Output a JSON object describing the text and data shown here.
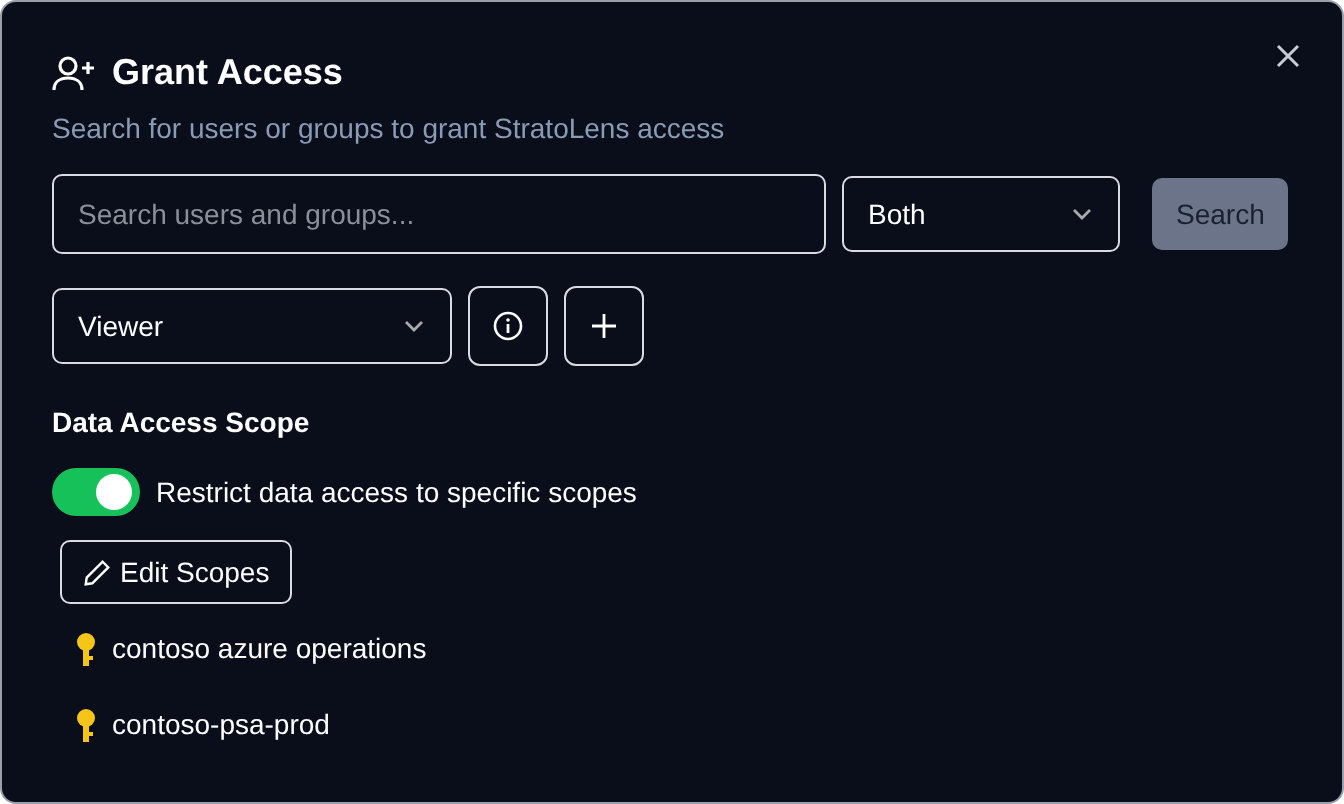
{
  "dialog": {
    "title": "Grant Access",
    "subtitle": "Search for users or groups to grant StratoLens access"
  },
  "search": {
    "placeholder": "Search users and groups...",
    "type_filter": "Both",
    "button": {
      "label": "Search",
      "disabled": true
    }
  },
  "role": {
    "value": "Viewer"
  },
  "scope": {
    "heading": "Data Access Scope",
    "toggle": {
      "label": "Restrict data access to specific scopes",
      "on": true
    },
    "edit_button": "Edit Scopes",
    "items": [
      {
        "name": "contoso azure operations"
      },
      {
        "name": "contoso-psa-prod"
      }
    ]
  }
}
